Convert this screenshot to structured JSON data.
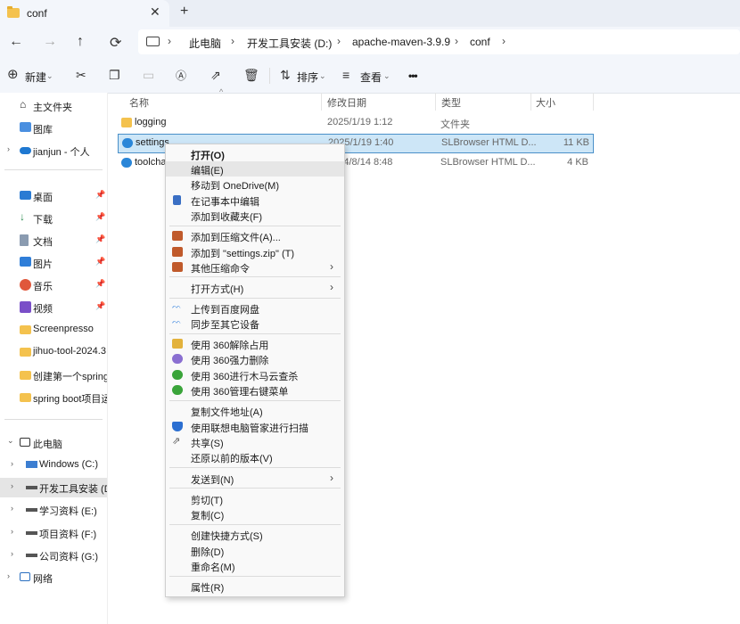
{
  "window": {
    "tab_title": "conf",
    "new_tab": "+",
    "close": "✕"
  },
  "nav": {
    "back": "←",
    "forward": "→",
    "up": "↑",
    "refresh": "⟳",
    "breadcrumb": [
      "此电脑",
      "开发工具安装 (D:)",
      "apache-maven-3.9.9",
      "conf"
    ]
  },
  "toolbar": {
    "new_label": "新建",
    "sort_label": "排序",
    "view_label": "查看",
    "more": "•••"
  },
  "sidebar": {
    "top": [
      {
        "label": "主文件夹",
        "icon": "home-icon"
      },
      {
        "label": "图库",
        "icon": "gallery-icon"
      },
      {
        "label": "jianjun - 个人",
        "icon": "onedrive-icon"
      }
    ],
    "quick": [
      {
        "label": "桌面",
        "icon": "desktop-icon"
      },
      {
        "label": "下载",
        "icon": "download-icon"
      },
      {
        "label": "文档",
        "icon": "document-icon"
      },
      {
        "label": "图片",
        "icon": "pictures-icon"
      },
      {
        "label": "音乐",
        "icon": "music-icon"
      },
      {
        "label": "视频",
        "icon": "video-icon"
      },
      {
        "label": "Screenpresso",
        "icon": "folder-icon"
      },
      {
        "label": "jihuo-tool-2024.3",
        "icon": "folder-icon"
      },
      {
        "label": "创建第一个spring b",
        "icon": "folder-icon"
      },
      {
        "label": "spring boot项目运",
        "icon": "folder-icon"
      }
    ],
    "pc": {
      "label": "此电脑"
    },
    "drives": [
      {
        "label": "Windows (C:)"
      },
      {
        "label": "开发工具安装 (D:)"
      },
      {
        "label": "学习资料 (E:)"
      },
      {
        "label": "项目资料 (F:)"
      },
      {
        "label": "公司资料 (G:)"
      }
    ],
    "network": {
      "label": "网络"
    }
  },
  "columns": {
    "name": "名称",
    "date": "修改日期",
    "type": "类型",
    "size": "大小"
  },
  "files": [
    {
      "name": "logging",
      "date": "2025/1/19 1:12",
      "type": "文件夹",
      "size": ""
    },
    {
      "name": "settings",
      "date": "2025/1/19 1:40",
      "type": "SLBrowser HTML D...",
      "size": "11 KB"
    },
    {
      "name": "toolcha",
      "date": "2024/8/14 8:48",
      "type": "SLBrowser HTML D...",
      "size": "4 KB"
    }
  ],
  "menu": [
    {
      "label": "打开(O)",
      "bold": true
    },
    {
      "label": "编辑(E)",
      "highlight": true
    },
    {
      "label": "移动到 OneDrive(M)"
    },
    {
      "label": "在记事本中编辑",
      "icon": "notepad-icon",
      "color": "#3a6fc4"
    },
    {
      "label": "添加到收藏夹(F)"
    },
    {
      "label": "添加到压缩文件(A)...",
      "icon": "archive-icon",
      "color": "#c05a2b"
    },
    {
      "label": "添加到 \"settings.zip\" (T)",
      "icon": "archive-icon",
      "color": "#c05a2b"
    },
    {
      "label": "其他压缩命令",
      "icon": "archive-icon",
      "color": "#c05a2b",
      "submenu": true
    },
    {
      "label": "打开方式(H)",
      "submenu": true
    },
    {
      "label": "上传到百度网盘",
      "icon": "baidu-cloud-icon",
      "color": "#4a8fe0"
    },
    {
      "label": "同步至其它设备",
      "icon": "baidu-cloud-icon",
      "color": "#4a8fe0"
    },
    {
      "label": "使用 360解除占用",
      "icon": "360-unlock-icon",
      "color": "#e3b23c"
    },
    {
      "label": "使用 360强力删除",
      "icon": "360-delete-icon",
      "color": "#8a6fd1"
    },
    {
      "label": "使用 360进行木马云查杀",
      "icon": "360-scan-icon",
      "color": "#3aa43a"
    },
    {
      "label": "使用 360管理右键菜单",
      "icon": "360-menu-icon",
      "color": "#3aa43a"
    },
    {
      "label": "复制文件地址(A)"
    },
    {
      "label": "使用联想电脑管家进行扫描",
      "icon": "lenovo-shield-icon",
      "color": "#2b6fd1"
    },
    {
      "label": "共享(S)",
      "icon": "share-icon",
      "color": "#555555"
    },
    {
      "label": "还原以前的版本(V)"
    },
    {
      "label": "发送到(N)",
      "submenu": true
    },
    {
      "label": "剪切(T)"
    },
    {
      "label": "复制(C)"
    },
    {
      "label": "创建快捷方式(S)"
    },
    {
      "label": "删除(D)"
    },
    {
      "label": "重命名(M)"
    },
    {
      "label": "属性(R)"
    }
  ],
  "colors": {
    "accent": "#0067c0",
    "selection": "#cde6f7",
    "folder": "#f4c24e"
  }
}
